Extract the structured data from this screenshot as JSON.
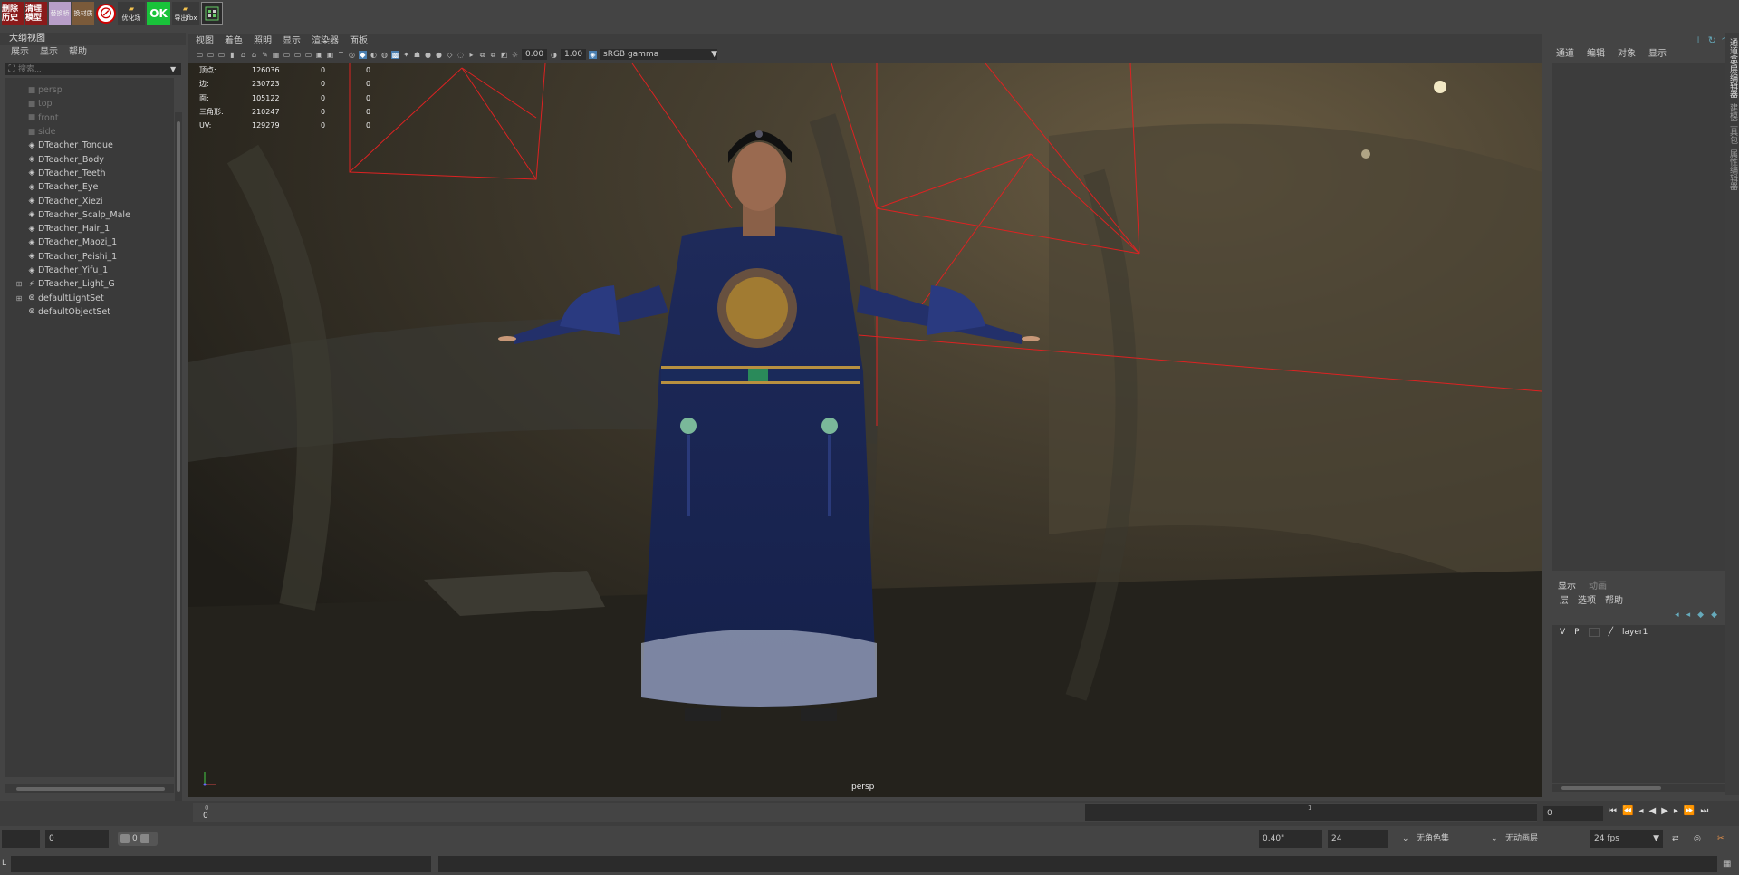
{
  "shelf": {
    "buttons": [
      {
        "label": "删除历史",
        "style": "red"
      },
      {
        "label": "清理模型",
        "style": "red"
      },
      {
        "label": "替换桥",
        "style": "light"
      },
      {
        "label": "换材质",
        "style": "face"
      },
      {
        "label": "⊘",
        "style": "no"
      },
      {
        "label": "优化场",
        "style": "folder"
      },
      {
        "label": "OK",
        "style": "ok"
      },
      {
        "label": "导出fbx",
        "style": "folder"
      },
      {
        "label": "",
        "style": "grid"
      }
    ]
  },
  "outliner": {
    "title": "大纲视图",
    "menu": [
      "展示",
      "显示",
      "帮助"
    ],
    "search_placeholder": "搜索...",
    "items": [
      {
        "label": "persp",
        "icon": "camera-icon",
        "dim": true,
        "expandable": false
      },
      {
        "label": "top",
        "icon": "camera-icon",
        "dim": true,
        "expandable": false
      },
      {
        "label": "front",
        "icon": "camera-icon",
        "dim": true,
        "expandable": false
      },
      {
        "label": "side",
        "icon": "camera-icon",
        "dim": true,
        "expandable": false
      },
      {
        "label": "DTeacher_Tongue",
        "icon": "mesh-icon",
        "dim": false,
        "expandable": false
      },
      {
        "label": "DTeacher_Body",
        "icon": "mesh-icon",
        "dim": false,
        "expandable": false
      },
      {
        "label": "DTeacher_Teeth",
        "icon": "mesh-icon",
        "dim": false,
        "expandable": false
      },
      {
        "label": "DTeacher_Eye",
        "icon": "mesh-icon",
        "dim": false,
        "expandable": false
      },
      {
        "label": "DTeacher_Xiezi",
        "icon": "mesh-icon",
        "dim": false,
        "expandable": false
      },
      {
        "label": "DTeacher_Scalp_Male",
        "icon": "mesh-icon",
        "dim": false,
        "expandable": false
      },
      {
        "label": "DTeacher_Hair_1",
        "icon": "mesh-icon",
        "dim": false,
        "expandable": false
      },
      {
        "label": "DTeacher_Maozi_1",
        "icon": "mesh-icon",
        "dim": false,
        "expandable": false
      },
      {
        "label": "DTeacher_Peishi_1",
        "icon": "mesh-icon",
        "dim": false,
        "expandable": false
      },
      {
        "label": "DTeacher_Yifu_1",
        "icon": "mesh-icon",
        "dim": false,
        "expandable": false
      },
      {
        "label": "DTeacher_Light_G",
        "icon": "light-group-icon",
        "dim": false,
        "expandable": true
      },
      {
        "label": "defaultLightSet",
        "icon": "set-icon",
        "dim": false,
        "expandable": true
      },
      {
        "label": "defaultObjectSet",
        "icon": "set-icon",
        "dim": false,
        "expandable": false
      }
    ]
  },
  "viewport": {
    "menu": [
      "视图",
      "着色",
      "照明",
      "显示",
      "渲染器",
      "面板"
    ],
    "exposure": "0.00",
    "gamma": "1.00",
    "colorspace": "sRGB gamma",
    "camera": "persp",
    "hud": [
      {
        "label": "顶点:",
        "a": "126036",
        "b": "0",
        "c": "0"
      },
      {
        "label": "边:",
        "a": "230723",
        "b": "0",
        "c": "0"
      },
      {
        "label": "面:",
        "a": "105122",
        "b": "0",
        "c": "0"
      },
      {
        "label": "三角形:",
        "a": "210247",
        "b": "0",
        "c": "0"
      },
      {
        "label": "UV:",
        "a": "129279",
        "b": "0",
        "c": "0"
      }
    ]
  },
  "channel_box": {
    "menu": [
      "通道",
      "编辑",
      "对象",
      "显示"
    ],
    "layer_tabs": [
      "显示",
      "动画"
    ],
    "layer_menu": [
      "层",
      "选项",
      "帮助"
    ],
    "layers": [
      {
        "v": "V",
        "p": "P",
        "name": "layer1"
      }
    ]
  },
  "side_tabs": [
    "通道盒/层编辑器",
    "建模工具包",
    "属性编辑器"
  ],
  "timeslider": {
    "tick_start": "0",
    "start_value": "0",
    "tick_one": "1",
    "current_frame": "0"
  },
  "range": {
    "start": "",
    "playback_start": "0",
    "slider_value": "0",
    "anim_end": "0.40\"",
    "playback_end": "24",
    "character_set": "无角色集",
    "anim_layer": "无动画层",
    "fps": "24 fps"
  },
  "cmdline": {
    "lang": "L"
  }
}
